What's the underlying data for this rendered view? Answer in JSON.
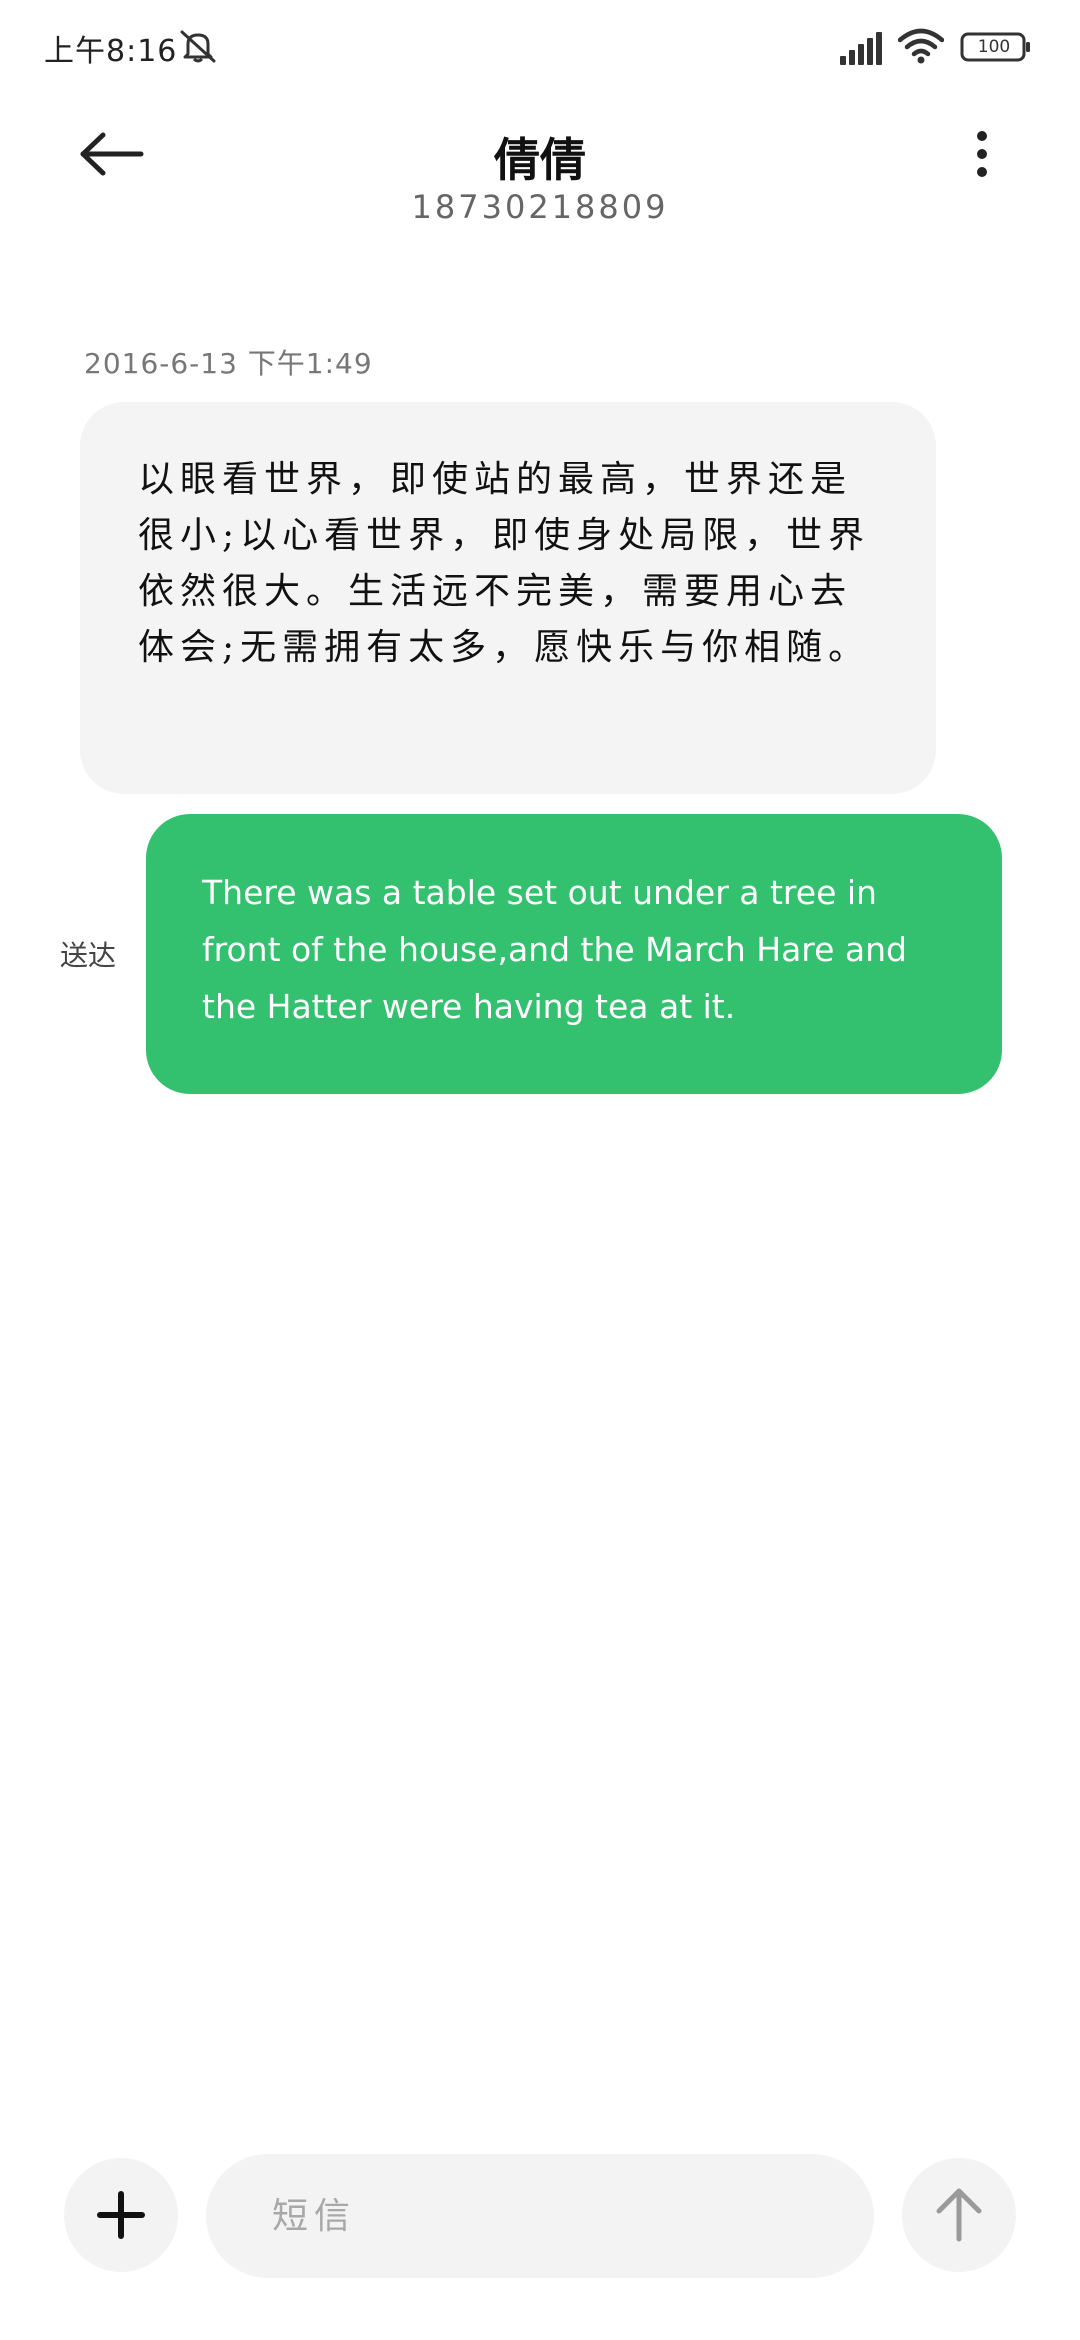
{
  "status_bar": {
    "time": "上午8:16",
    "battery_level": "100",
    "icons": [
      "mute-icon",
      "signal-icon",
      "wifi-icon",
      "battery-icon"
    ]
  },
  "header": {
    "contact_name": "倩倩",
    "phone_number": "18730218809",
    "icons": [
      "back-arrow-icon",
      "more-vertical-icon"
    ]
  },
  "conversation": {
    "timestamp": "2016-6-13 下午1:49",
    "messages": [
      {
        "direction": "received",
        "text": "以眼看世界，即使站的最高，世界还是很小;以心看世界，即使身处局限，世界依然很大。生活远不完美，需要用心去体会;无需拥有太多，愿快乐与你相随。"
      },
      {
        "direction": "sent",
        "text": "There was a table set out under a tree in front of the house,and the March Hare and the Hatter were having tea at it.",
        "status": "送达"
      }
    ]
  },
  "input_bar": {
    "placeholder": "短信",
    "value": "",
    "icons": [
      "plus-icon",
      "send-arrow-icon"
    ]
  },
  "colors": {
    "sent_bubble": "#34c16f",
    "received_bubble": "#f4f4f4",
    "background": "#ffffff"
  }
}
